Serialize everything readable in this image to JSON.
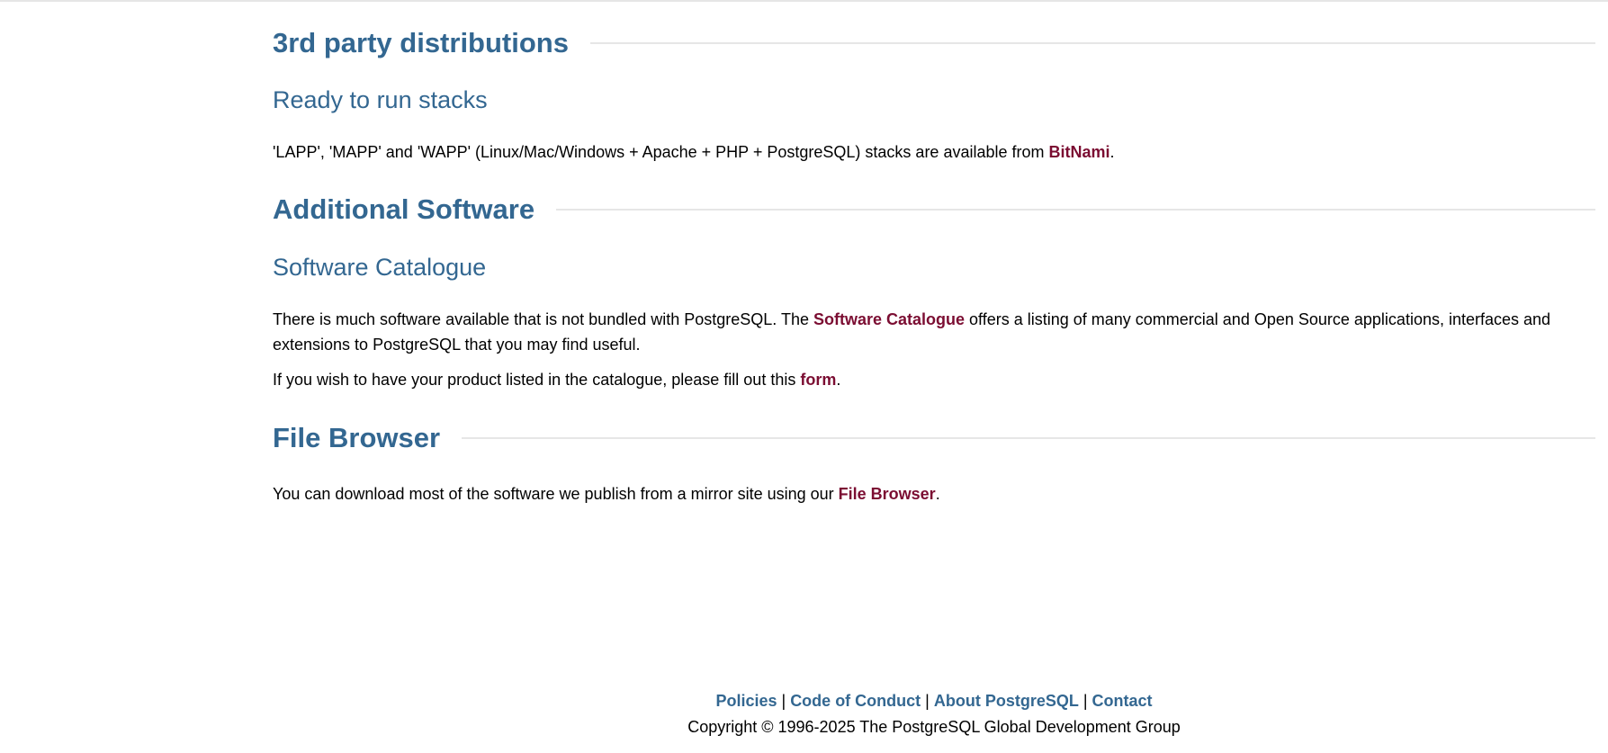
{
  "sections": [
    {
      "title": "3rd party distributions",
      "subtitle": "Ready to run stacks",
      "text_before": "'LAPP', 'MAPP' and 'WAPP' (Linux/Mac/Windows + Apache + PHP + PostgreSQL) stacks are available from ",
      "link": "BitNami",
      "text_after": "."
    },
    {
      "title": "Additional Software",
      "subtitle": "Software Catalogue",
      "p1_before": "There is much software available that is not bundled with PostgreSQL. The ",
      "p1_link": "Software Catalogue",
      "p1_after": " offers a listing of many commercial and Open Source applications, interfaces and extensions to PostgreSQL that you may find useful.",
      "p2_before": "If you wish to have your product listed in the catalogue, please fill out this ",
      "p2_link": "form",
      "p2_after": "."
    },
    {
      "title": "File Browser",
      "text_before": "You can download most of the software we publish from a mirror site using our ",
      "link": "File Browser",
      "text_after": "."
    }
  ],
  "footer": {
    "links": [
      "Policies",
      "Code of Conduct",
      "About PostgreSQL",
      "Contact"
    ],
    "separator": " | ",
    "copyright": "Copyright © 1996-2025 The PostgreSQL Global Development Group"
  }
}
